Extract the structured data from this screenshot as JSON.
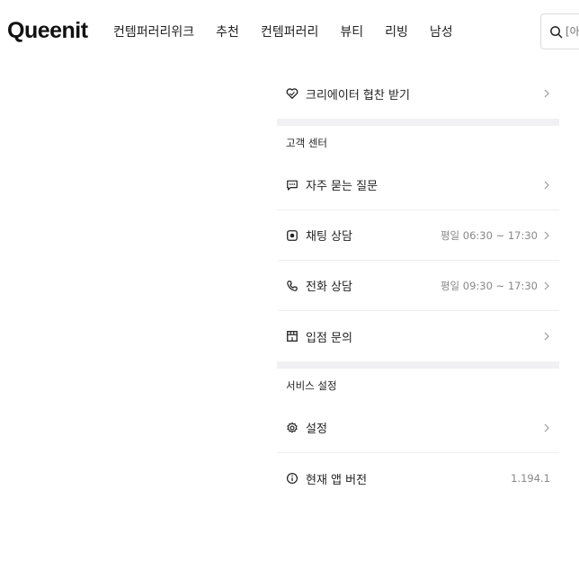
{
  "header": {
    "logo": "Queenit",
    "nav": [
      {
        "label": "컨템퍼러리위크",
        "name": "nav-contemporary-week"
      },
      {
        "label": "추천",
        "name": "nav-recommend"
      },
      {
        "label": "컨템퍼러리",
        "name": "nav-contemporary"
      },
      {
        "label": "뷰티",
        "name": "nav-beauty"
      },
      {
        "label": "리빙",
        "name": "nav-living"
      },
      {
        "label": "남성",
        "name": "nav-men"
      }
    ],
    "search": {
      "placeholder": "[아맘",
      "icon": "search-icon"
    }
  },
  "menu": {
    "creator": {
      "label": "크리에이터 협찬 받기",
      "icon": "heart-hand-icon"
    },
    "support": {
      "title": "고객 센터",
      "items": [
        {
          "label": "자주 묻는 질문",
          "icon": "chat-icon",
          "sub": ""
        },
        {
          "label": "채팅 상담",
          "icon": "chat-bubble-icon",
          "sub": "평일 06:30 ~ 17:30"
        },
        {
          "label": "전화 상담",
          "icon": "phone-icon",
          "sub": "평일 09:30 ~ 17:30"
        },
        {
          "label": "입점 문의",
          "icon": "store-icon",
          "sub": ""
        }
      ]
    },
    "service": {
      "title": "서비스 설정",
      "settings": {
        "label": "설정",
        "icon": "gear-icon"
      },
      "version": {
        "label": "현재 앱 버전",
        "icon": "info-icon",
        "value": "1.194.1"
      }
    }
  },
  "colors": {
    "text": "#222222",
    "muted": "#888888",
    "divider": "#eeeeee",
    "section_gap": "#f1f1f3"
  }
}
